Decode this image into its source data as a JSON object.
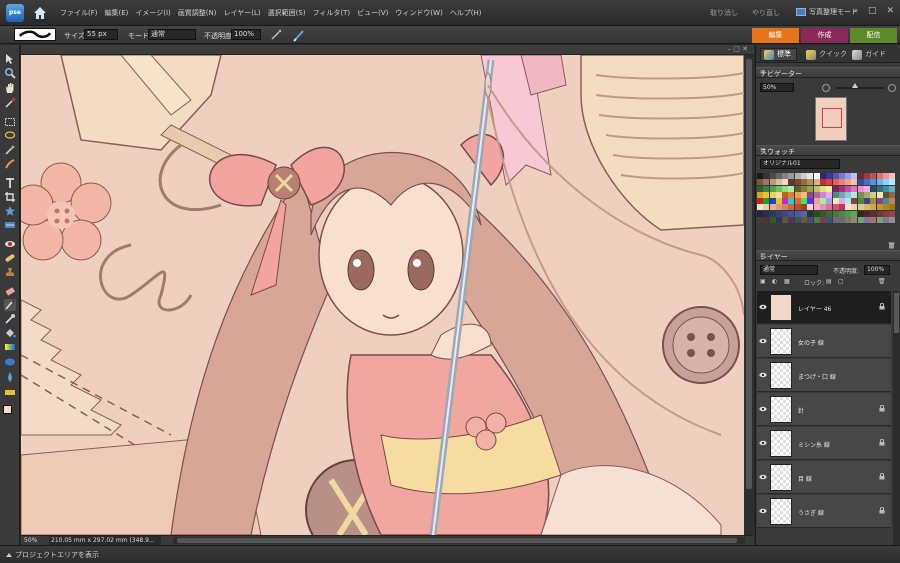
{
  "app": {
    "logo_text": "pse"
  },
  "menu": [
    "ファイル(F)",
    "編集(E)",
    "イメージ(I)",
    "画質調整(N)",
    "レイヤー(L)",
    "選択範囲(S)",
    "フィルタ(T)",
    "ビュー(V)",
    "ウィンドウ(W)",
    "ヘルプ(H)"
  ],
  "titlebar": {
    "undo": "取り消し",
    "redo": "やり直し",
    "organizer": "写真整理モード"
  },
  "options": {
    "size_label": "サイズ:",
    "size_value": "55 px",
    "mode_label": "モード:",
    "mode_value": "通常",
    "opacity_label": "不透明度:",
    "opacity_value": "100%"
  },
  "mode_tabs": {
    "edit": "編集",
    "create": "作成",
    "share": "配信"
  },
  "palette_tabs": {
    "full": "標準",
    "quick": "クイック",
    "guided": "ガイド"
  },
  "navigator": {
    "title": "ナビゲーター",
    "zoom": "50%"
  },
  "swatches": {
    "title": "スウォッチ",
    "set": "オリジナル01",
    "colors": [
      "#1a1a1a",
      "#333333",
      "#4d4d4d",
      "#666666",
      "#808080",
      "#999999",
      "#b3b3b3",
      "#cccccc",
      "#e6e6e6",
      "#ffffff",
      "#2b2b6b",
      "#3b3b9b",
      "#5555bb",
      "#7777dd",
      "#9999ee",
      "#bbbbff",
      "#6b2b2b",
      "#9b3b3b",
      "#bb5555",
      "#dd7777",
      "#ee9999",
      "#ffbbbb",
      "#7a5a3a",
      "#9a7a5a",
      "#ba9a7a",
      "#dabaa0",
      "#f0d8c0",
      "#5a3a2a",
      "#7a4a2a",
      "#9a6a3a",
      "#ba8a5a",
      "#dab08a",
      "#c03030",
      "#e04040",
      "#f06050",
      "#f08070",
      "#f0a090",
      "#f0c0b0",
      "#3050a0",
      "#4070c0",
      "#5090e0",
      "#70b0f0",
      "#90d0ff",
      "#b0e8ff",
      "#306030",
      "#408040",
      "#50a050",
      "#70c060",
      "#90e080",
      "#b0f0a0",
      "#606020",
      "#808030",
      "#a0a040",
      "#c0c060",
      "#e0e080",
      "#f0f0a0",
      "#802060",
      "#a03080",
      "#c050a0",
      "#e070c0",
      "#f090d0",
      "#f0b0e0",
      "#205060",
      "#307080",
      "#4090a0",
      "#60b0c0",
      "#e0a020",
      "#f0c030",
      "#f0d060",
      "#f0e090",
      "#c06020",
      "#e08030",
      "#f0a050",
      "#f0c080",
      "#8a4a8a",
      "#aa6aaa",
      "#ca8aca",
      "#eaaaea",
      "#4a8a8a",
      "#6aaaaa",
      "#8acaca",
      "#aaeaea",
      "#8a8a4a",
      "#aaaa6a",
      "#caca8a",
      "#eaeaaa",
      "#6a4a2a",
      "#8a6a4a",
      "#d02020",
      "#20a020",
      "#2040d0",
      "#d0d020",
      "#d020d0",
      "#20d0d0",
      "#f06030",
      "#30f060",
      "#6030f0",
      "#f0a0a0",
      "#a0f0a0",
      "#a0a0f0",
      "#f0f0a0",
      "#f0a0f0",
      "#a0f0f0",
      "#904040",
      "#409040",
      "#404090",
      "#909040",
      "#904090",
      "#409090",
      "#c08060",
      "#f8e0d0",
      "#f0c8b0",
      "#e8b090",
      "#e09878",
      "#d88060",
      "#c86848",
      "#b85030",
      "#a04020",
      "#f8d0d8",
      "#f0b0c0",
      "#e890a8",
      "#e07090",
      "#d85078",
      "#c83060",
      "#f0e8c8",
      "#e8d8a8",
      "#e0c888",
      "#d8b868",
      "#d0a848",
      "#c09830",
      "#b08820",
      "#a07810",
      "#202840",
      "#283050",
      "#303860",
      "#384070",
      "#404880",
      "#485090",
      "#5058a0",
      "#5860b0",
      "#283820",
      "#304828",
      "#385830",
      "#406838",
      "#487840",
      "#508848",
      "#589850",
      "#60a858",
      "#402020",
      "#502828",
      "#603030",
      "#703838",
      "#804040",
      "#904848",
      "#404040",
      "#5a3030",
      "#305a30",
      "#30305a",
      "#5a5a30",
      "#5a305a",
      "#305a5a",
      "#7a5040",
      "#40507a",
      "#507a40",
      "#7a4050",
      "#40507a",
      "#607080",
      "#806070",
      "#708060",
      "#a08070",
      "#70a080",
      "#8070a0",
      "#a07080",
      "#80a070",
      "#7080a0",
      "#909090"
    ]
  },
  "layers_panel": {
    "title": "レイヤー",
    "blend_mode": "通常",
    "opacity_label": "不透明度:",
    "opacity_value": "100%",
    "lock_label": "ロック:",
    "layers": [
      {
        "name": "レイヤー 46",
        "active": true,
        "locked": true
      },
      {
        "name": "女の子 線",
        "active": false,
        "locked": false
      },
      {
        "name": "まつげ・口 線",
        "active": false,
        "locked": false
      },
      {
        "name": "針",
        "active": false,
        "locked": true
      },
      {
        "name": "ミシン糸 線",
        "active": false,
        "locked": true
      },
      {
        "name": "目 線",
        "active": false,
        "locked": true
      },
      {
        "name": "うさぎ 線",
        "active": false,
        "locked": true
      }
    ]
  },
  "status": {
    "zoom": "50%",
    "doc_size": "210.05 mm x 297.02 mm (348.9..."
  },
  "bottom": {
    "project_bin": "プロジェクトエリアを表示"
  }
}
